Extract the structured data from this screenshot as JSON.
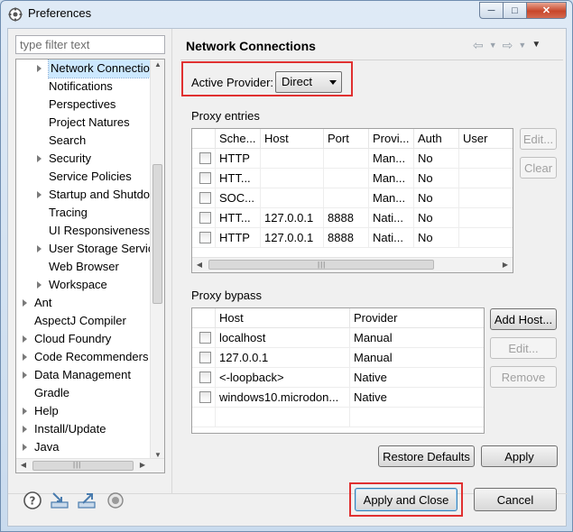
{
  "window": {
    "title": "Preferences"
  },
  "filter": {
    "placeholder": "type filter text"
  },
  "tree": {
    "items": [
      {
        "label": "Network Connectio",
        "indent": 1,
        "expandable": true,
        "selected": true
      },
      {
        "label": "Notifications",
        "indent": 1,
        "expandable": false
      },
      {
        "label": "Perspectives",
        "indent": 1,
        "expandable": false
      },
      {
        "label": "Project Natures",
        "indent": 1,
        "expandable": false
      },
      {
        "label": "Search",
        "indent": 1,
        "expandable": false
      },
      {
        "label": "Security",
        "indent": 1,
        "expandable": true
      },
      {
        "label": "Service Policies",
        "indent": 1,
        "expandable": false
      },
      {
        "label": "Startup and Shutdo",
        "indent": 1,
        "expandable": true
      },
      {
        "label": "Tracing",
        "indent": 1,
        "expandable": false
      },
      {
        "label": "UI Responsiveness",
        "indent": 1,
        "expandable": false
      },
      {
        "label": "User Storage Servic",
        "indent": 1,
        "expandable": true
      },
      {
        "label": "Web Browser",
        "indent": 1,
        "expandable": false
      },
      {
        "label": "Workspace",
        "indent": 1,
        "expandable": true
      },
      {
        "label": "Ant",
        "indent": 0,
        "expandable": true
      },
      {
        "label": "AspectJ Compiler",
        "indent": 0,
        "expandable": false
      },
      {
        "label": "Cloud Foundry",
        "indent": 0,
        "expandable": true
      },
      {
        "label": "Code Recommenders",
        "indent": 0,
        "expandable": true
      },
      {
        "label": "Data Management",
        "indent": 0,
        "expandable": true
      },
      {
        "label": "Gradle",
        "indent": 0,
        "expandable": false
      },
      {
        "label": "Help",
        "indent": 0,
        "expandable": true
      },
      {
        "label": "Install/Update",
        "indent": 0,
        "expandable": true
      },
      {
        "label": "Java",
        "indent": 0,
        "expandable": true
      }
    ]
  },
  "page": {
    "title": "Network Connections",
    "active_provider_label": "Active Provider:",
    "active_provider_value": "Direct"
  },
  "proxy_entries": {
    "label": "Proxy entries",
    "columns": [
      "Sche...",
      "Host",
      "Port",
      "Provi...",
      "Auth",
      "User"
    ],
    "rows": [
      [
        "HTTP",
        "",
        "",
        "Man...",
        "No",
        ""
      ],
      [
        "HTT...",
        "",
        "",
        "Man...",
        "No",
        ""
      ],
      [
        "SOC...",
        "",
        "",
        "Man...",
        "No",
        ""
      ],
      [
        "HTT...",
        "127.0.0.1",
        "8888",
        "Nati...",
        "No",
        ""
      ],
      [
        "HTTP",
        "127.0.0.1",
        "8888",
        "Nati...",
        "No",
        ""
      ]
    ],
    "edit_label": "Edit...",
    "clear_label": "Clear"
  },
  "proxy_bypass": {
    "label": "Proxy bypass",
    "columns": [
      "Host",
      "Provider"
    ],
    "rows": [
      [
        "localhost",
        "Manual"
      ],
      [
        "127.0.0.1",
        "Manual"
      ],
      [
        "<-loopback>",
        "Native"
      ],
      [
        "windows10.microdon...",
        "Native"
      ]
    ],
    "add_host_label": "Add Host...",
    "edit_label": "Edit...",
    "remove_label": "Remove"
  },
  "buttons": {
    "restore_defaults": "Restore Defaults",
    "apply": "Apply",
    "apply_and_close": "Apply and Close",
    "cancel": "Cancel"
  },
  "colors": {
    "highlight_box": "#e03030",
    "selection": "#cce8ff"
  }
}
